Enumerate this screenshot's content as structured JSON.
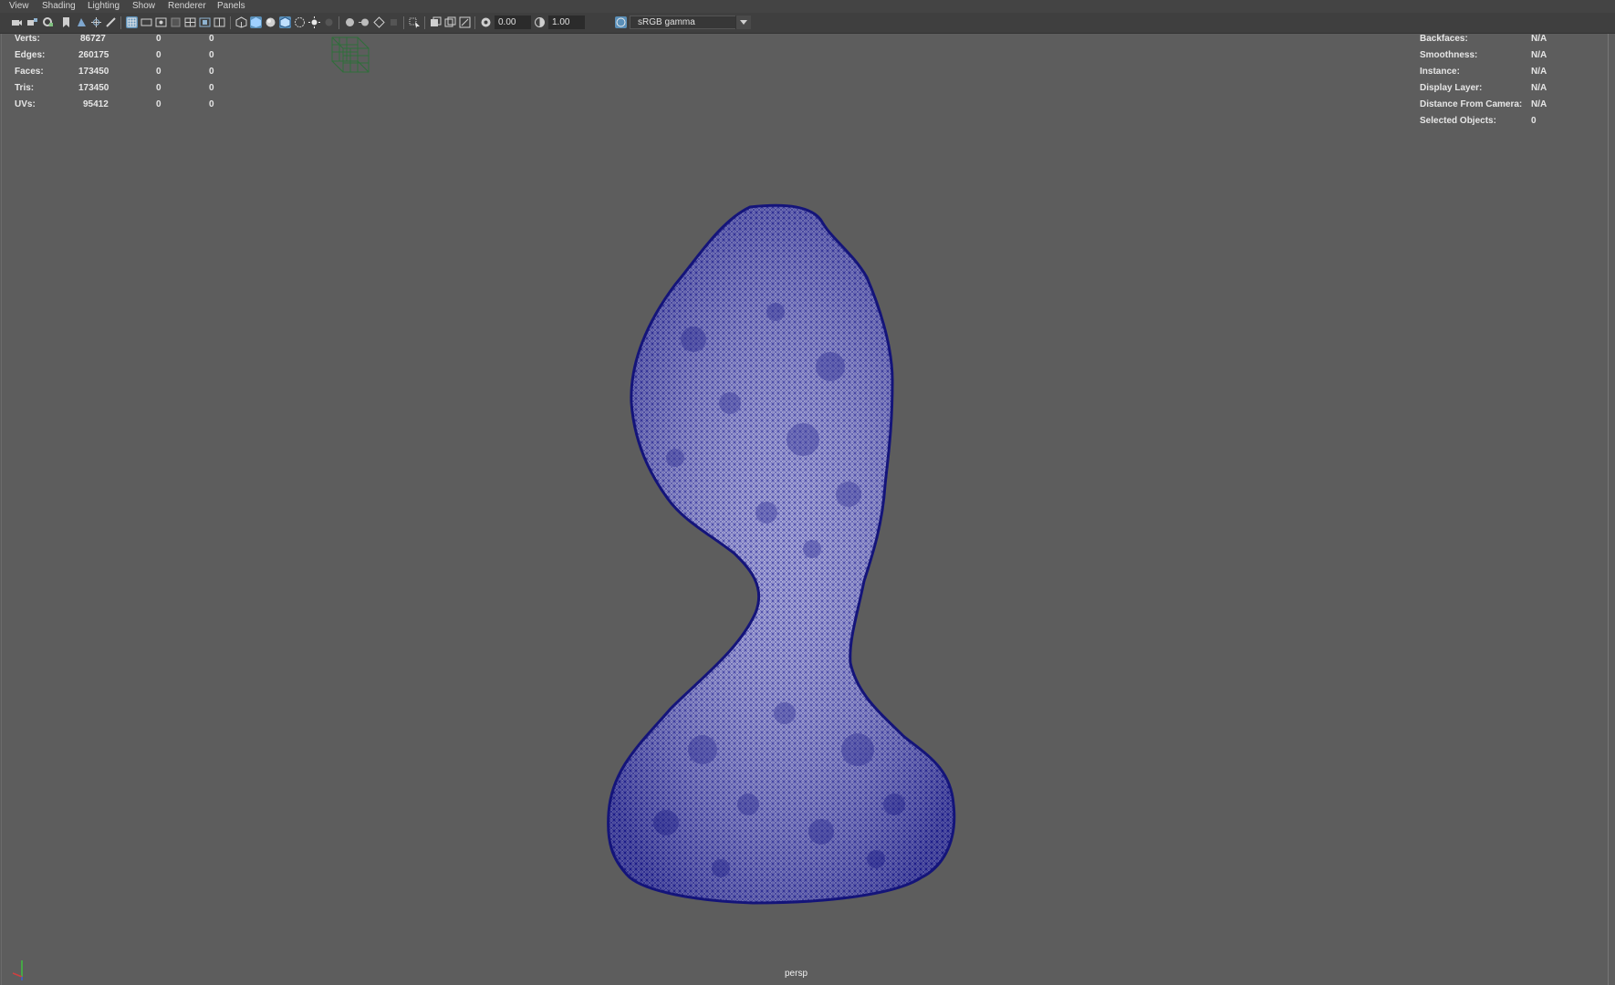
{
  "menu": [
    "View",
    "Shading",
    "Lighting",
    "Show",
    "Renderer",
    "Panels"
  ],
  "toolbar": {
    "exposure": "0.00",
    "gamma": "1.00",
    "color_space": "sRGB gamma"
  },
  "stats": [
    {
      "label": "Verts:",
      "value": "86727",
      "sel": "0",
      "comp": "0"
    },
    {
      "label": "Edges:",
      "value": "260175",
      "sel": "0",
      "comp": "0"
    },
    {
      "label": "Faces:",
      "value": "173450",
      "sel": "0",
      "comp": "0"
    },
    {
      "label": "Tris:",
      "value": "173450",
      "sel": "0",
      "comp": "0"
    },
    {
      "label": "UVs:",
      "value": "95412",
      "sel": "0",
      "comp": "0"
    }
  ],
  "info": [
    {
      "label": "Backfaces:",
      "value": "N/A"
    },
    {
      "label": "Smoothness:",
      "value": "N/A"
    },
    {
      "label": "Instance:",
      "value": "N/A"
    },
    {
      "label": "Display Layer:",
      "value": "N/A"
    },
    {
      "label": "Distance From Camera:",
      "value": "N/A"
    },
    {
      "label": "Selected Objects:",
      "value": "0"
    }
  ],
  "camera": "persp",
  "colors": {
    "viewport_bg": "#5d5d5d",
    "mesh_wire": "#1a1a8c",
    "mesh_fill": "#9a9ad0",
    "active_icon": "#5a8fb8"
  }
}
